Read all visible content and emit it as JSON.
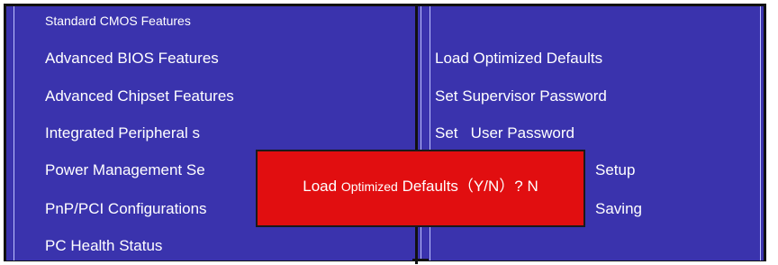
{
  "colors": {
    "background": "#3a33ad",
    "text": "#ffffff",
    "dialog": "#e10e10",
    "border": "#111111"
  },
  "menu_left": [
    {
      "label": "Standard CMOS Features"
    },
    {
      "label": "Advanced BIOS Features"
    },
    {
      "label": "Advanced Chipset Features"
    },
    {
      "label": "Integrated Peripheral s"
    },
    {
      "label": "Power Management Se"
    },
    {
      "label": "PnP/PCI Configurations"
    },
    {
      "label": "PC Health Status"
    }
  ],
  "menu_right": [
    {
      "label": ""
    },
    {
      "label": "Load Optimized Defaults"
    },
    {
      "label": "Set Supervisor Password"
    },
    {
      "label": "Set   User Password"
    },
    {
      "label": "Setup"
    },
    {
      "label": "Saving"
    }
  ],
  "dialog": {
    "word1": "Load ",
    "word2": "Optimized",
    "word3": " Defaults（Y/N）? N"
  }
}
